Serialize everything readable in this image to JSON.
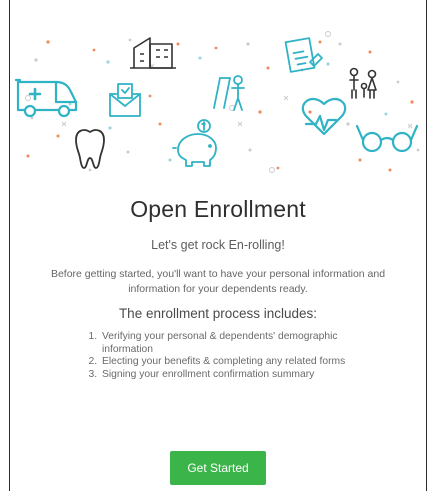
{
  "page": {
    "title": "Open Enrollment",
    "subtitle": "Let's get rock En-rolling!",
    "intro": "Before getting started, you'll want to have your personal information and information for your dependents ready.",
    "process_heading": "The enrollment process includes:",
    "steps": [
      "Verifying your personal & dependents' demographic information",
      "Electing your benefits & completing any related forms",
      "Signing your enrollment confirmation summary"
    ],
    "cta_label": "Get Started"
  },
  "banner": {
    "icons": [
      "ambulance-icon",
      "tooth-icon",
      "mail-icon",
      "building-icon",
      "piggy-bank-icon",
      "calendar-icon",
      "document-icon",
      "heart-rate-icon",
      "family-icon",
      "glasses-icon"
    ]
  },
  "colors": {
    "icon_stroke": "#2fb3c5",
    "dark_stroke": "#333333",
    "button": "#3bb54a",
    "dot_orange": "#ef8a5b"
  }
}
